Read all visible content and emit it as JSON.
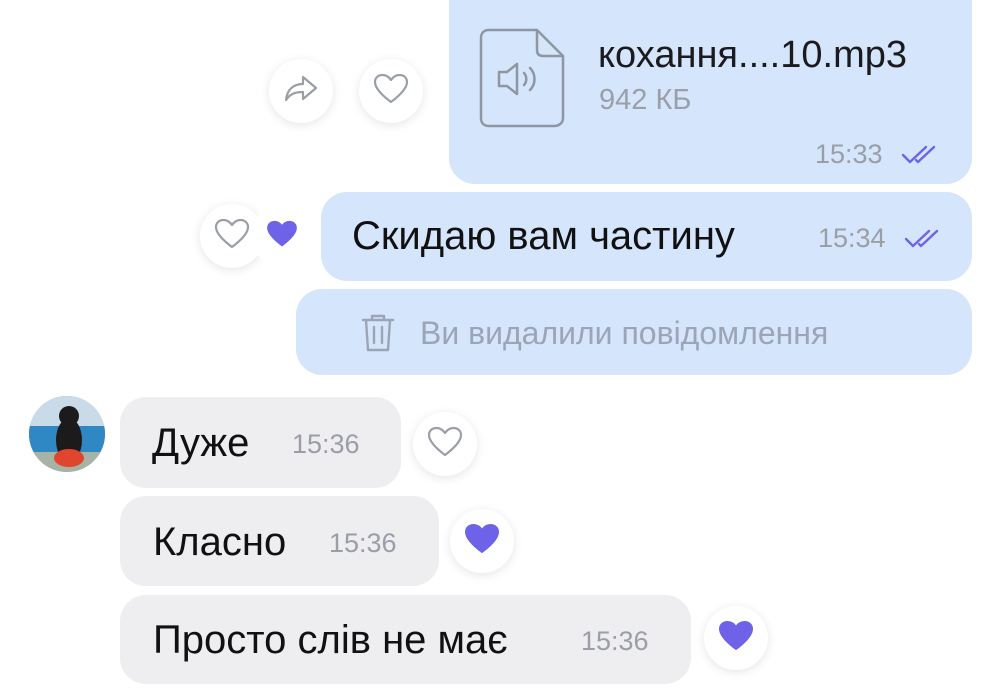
{
  "colors": {
    "outgoing_bubble": "#d5e5fb",
    "incoming_bubble": "#eeeef1",
    "accent_purple": "#6e63e8",
    "time_gray": "#9a9ea6",
    "deleted_text": "#9ca5b5"
  },
  "messages": {
    "file": {
      "icon": "audio-file-icon",
      "name": "кохання....10.mp3",
      "size": "942 КБ",
      "time": "15:33",
      "status": "read"
    },
    "sent_text": {
      "text": "Скидаю вам частину",
      "time": "15:34",
      "status": "read"
    },
    "deleted": {
      "icon": "trash-icon",
      "text": "Ви видалили повідомлення"
    },
    "incoming": [
      {
        "text": "Дуже",
        "time": "15:36",
        "reaction": "heart-outline"
      },
      {
        "text": "Класно",
        "time": "15:36",
        "reaction": "heart-filled"
      },
      {
        "text": "Просто слів не має",
        "time": "15:36",
        "reaction": "heart-filled"
      }
    ]
  }
}
